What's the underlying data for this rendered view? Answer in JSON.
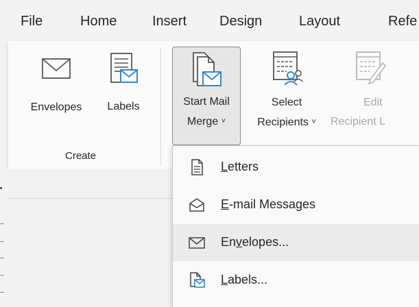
{
  "menubar": {
    "tabs": [
      {
        "label": "File"
      },
      {
        "label": "Home"
      },
      {
        "label": "Insert"
      },
      {
        "label": "Design"
      },
      {
        "label": "Layout"
      },
      {
        "label": "Refe"
      }
    ]
  },
  "ribbon": {
    "groups": {
      "create": {
        "label": "Create",
        "envelopes_label": "Envelopes",
        "labels_label": "Labels"
      },
      "start": {
        "start_mail_merge_line1": "Start Mail",
        "start_mail_merge_line2": "Merge",
        "select_recipients_line1": "Select",
        "select_recipients_line2": "Recipients",
        "edit_recipient_line1": "Edit",
        "edit_recipient_line2": "Recipient L"
      }
    },
    "caret": "˅"
  },
  "dropdown": {
    "items": [
      {
        "pre": "",
        "key": "L",
        "post": "etters"
      },
      {
        "pre": "",
        "key": "E",
        "post": "-mail Messages"
      },
      {
        "pre": "En",
        "key": "v",
        "post": "elopes..."
      },
      {
        "pre": "",
        "key": "L",
        "post": "abels..."
      }
    ],
    "hovered_index": 2
  },
  "colors": {
    "accent_blue": "#2b88d8",
    "hover_bg": "#ebebeb",
    "disabled_text": "#a6a6a6"
  },
  "icons": {
    "envelopes": "envelope-icon",
    "labels": "labels-icon",
    "start_mail_merge": "start-mail-merge-icon",
    "select_recipients": "select-recipients-icon",
    "edit_recipient": "edit-recipient-list-icon",
    "letters": "document-icon",
    "email": "open-envelope-icon",
    "envelopes_menu": "envelope-icon",
    "labels_menu": "labels-icon"
  }
}
